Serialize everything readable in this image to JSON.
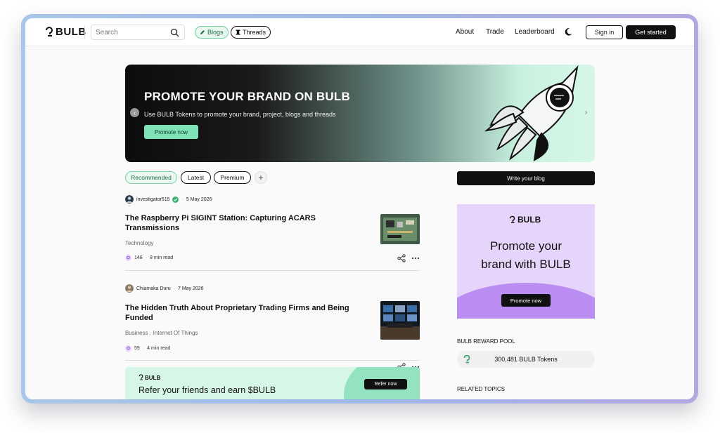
{
  "header": {
    "logo_text": "BULB",
    "search_placeholder": "Search",
    "tabs": [
      {
        "label": "Blogs"
      },
      {
        "label": "Threads"
      }
    ],
    "nav": [
      "About",
      "Trade",
      "Leaderboard"
    ],
    "sign_in_label": "Sign in",
    "get_started_label": "Get started"
  },
  "hero": {
    "title": "PROMOTE YOUR BRAND ON BULB",
    "subtitle": "Use BULB Tokens to promote your brand, project, blogs and threads",
    "button_label": "Promote now"
  },
  "feed_tabs": [
    "Recommended",
    "Latest",
    "Premium",
    "+"
  ],
  "articles": [
    {
      "author": "investigator515",
      "verified": true,
      "date": "5 May 2026",
      "title": "The Raspberry Pi SIGINT Station: Capturing ACARS Transmissions",
      "categories": "Technology",
      "tokens": "148",
      "read_time": "8 min read"
    },
    {
      "author": "Chiamaka Duru",
      "verified": false,
      "date": "7 May 2026",
      "title": "The Hidden Truth About Proprietary Trading Firms and Being Funded",
      "categories": "Business  ·  Internet Of Things",
      "tokens": "59",
      "read_time": "4 min read"
    }
  ],
  "refer": {
    "logo_text": "BULB",
    "title": "Refer your friends and earn $BULB",
    "button_label": "Refer now"
  },
  "sidebar": {
    "write_label": "Write your blog",
    "promo": {
      "logo_text": "BULB",
      "title_line1": "Promote your",
      "title_line2": "brand with BULB",
      "button_label": "Promote now"
    },
    "reward_pool_label": "BULB REWARD POOL",
    "reward_pool_value": "300,481 BULB Tokens",
    "related_topics_label": "RELATED TOPICS"
  },
  "colors": {
    "accent_green": "#7fe3b7",
    "promo_purple": "#e7d4fb",
    "dark": "#111111"
  }
}
